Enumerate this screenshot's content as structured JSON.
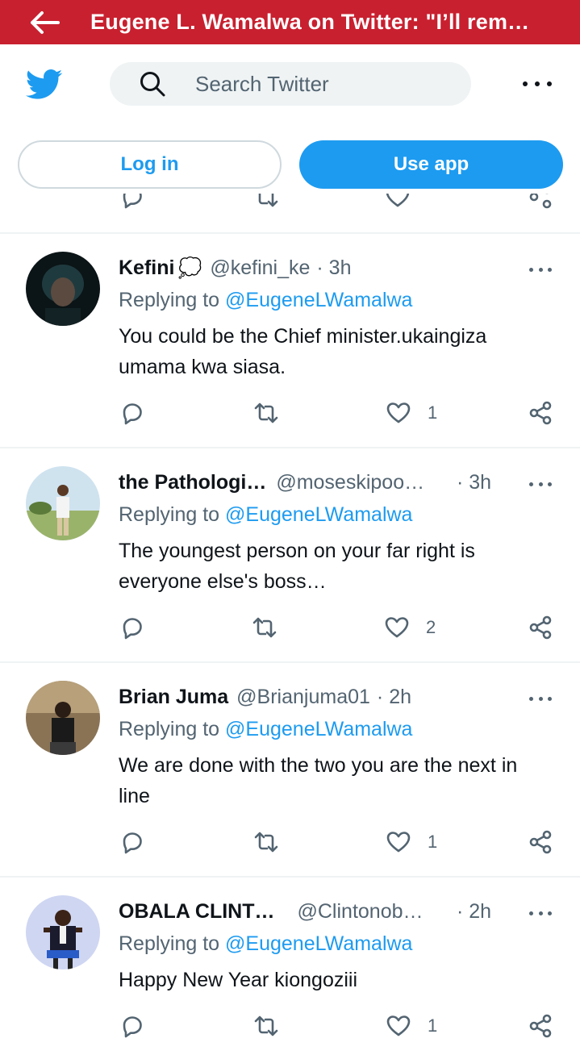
{
  "topbar": {
    "title": "Eugene L. Wamalwa on Twitter: \"I’ll rem…"
  },
  "search": {
    "placeholder": "Search Twitter"
  },
  "auth": {
    "login_label": "Log in",
    "useapp_label": "Use app"
  },
  "tweets": [
    {
      "name": "Kefini",
      "name_emoji": "💭",
      "handle": "@kefini_ke",
      "time": "· 3h",
      "reply_prefix": "Replying to",
      "reply_to": "@EugeneLWamalwa",
      "text": "You could be the Chief minister.ukaingiza umama kwa siasa.",
      "likes": "1"
    },
    {
      "name": "the Pathologi…",
      "handle": "@moseskipoo…",
      "time": "· 3h",
      "reply_prefix": "Replying to",
      "reply_to": "@EugeneLWamalwa",
      "text": "The youngest person on your far right is everyone else's boss…",
      "likes": "2"
    },
    {
      "name": "Brian Juma",
      "handle": "@Brianjuma01",
      "time": "· 2h",
      "reply_prefix": "Replying to",
      "reply_to": "@EugeneLWamalwa",
      "text": "We are done with the two you are the next in line",
      "likes": "1"
    },
    {
      "name": "OBALA CLINT…",
      "handle": "@Clintonob…",
      "time": "· 2h",
      "reply_prefix": "Replying to",
      "reply_to": "@EugeneLWamalwa",
      "text": "Happy New Year kiongoziii",
      "likes": "1"
    }
  ],
  "colors": {
    "topbar": "#c8202f",
    "accent": "#1d9bf0",
    "muted": "#536471"
  },
  "icons": [
    "back-arrow-icon",
    "twitter-bird-icon",
    "search-icon",
    "more-icon",
    "reply-icon",
    "retweet-icon",
    "like-icon",
    "share-icon"
  ]
}
